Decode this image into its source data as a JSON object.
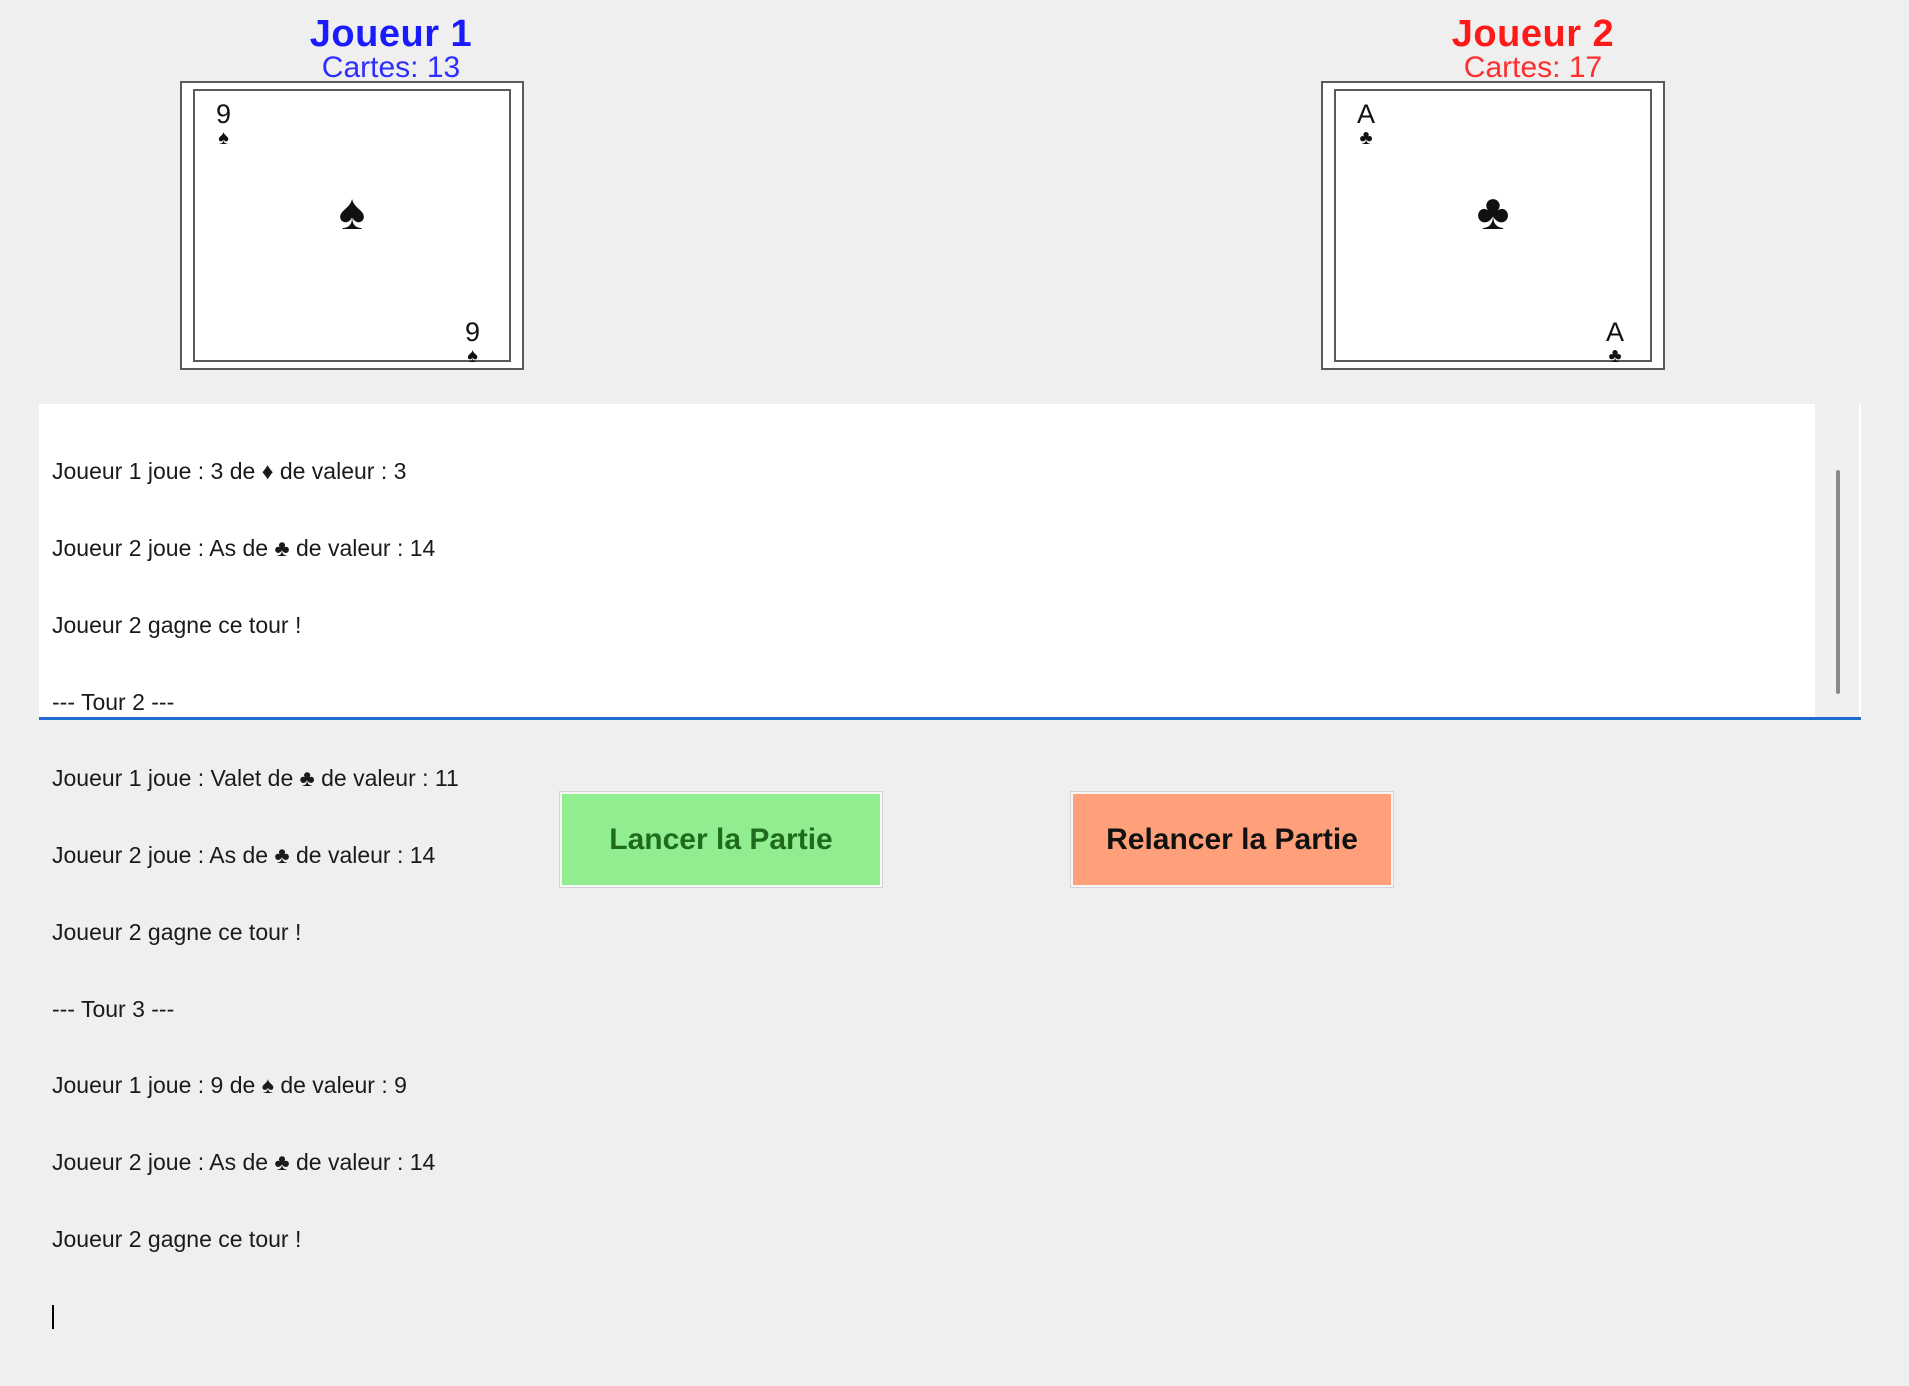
{
  "players": [
    {
      "name": "Joueur 1",
      "cards_label": "Cartes: 13",
      "color": "#1a1aff",
      "card": {
        "rank": "9",
        "suit": "♠"
      }
    },
    {
      "name": "Joueur 2",
      "cards_label": "Cartes: 17",
      "color": "#ff1a1a",
      "card": {
        "rank": "A",
        "suit": "♣"
      }
    }
  ],
  "log": {
    "lines": [
      "Joueur 1 joue : 3 de ♦ de valeur : 3",
      "Joueur 2 joue : As de ♣ de valeur : 14",
      "Joueur 2 gagne ce tour !",
      "--- Tour 2 ---",
      "Joueur 1 joue : Valet de ♣ de valeur : 11",
      "Joueur 2 joue : As de ♣ de valeur : 14",
      "Joueur 2 gagne ce tour !",
      "--- Tour 3 ---",
      "Joueur 1 joue : 9 de ♠ de valeur : 9",
      "Joueur 2 joue : As de ♣ de valeur : 14",
      "Joueur 2 gagne ce tour !"
    ]
  },
  "buttons": {
    "start_label": "Lancer la Partie",
    "restart_label": "Relancer la Partie",
    "start_color": "#90ee90",
    "restart_color": "#ffa07a"
  }
}
